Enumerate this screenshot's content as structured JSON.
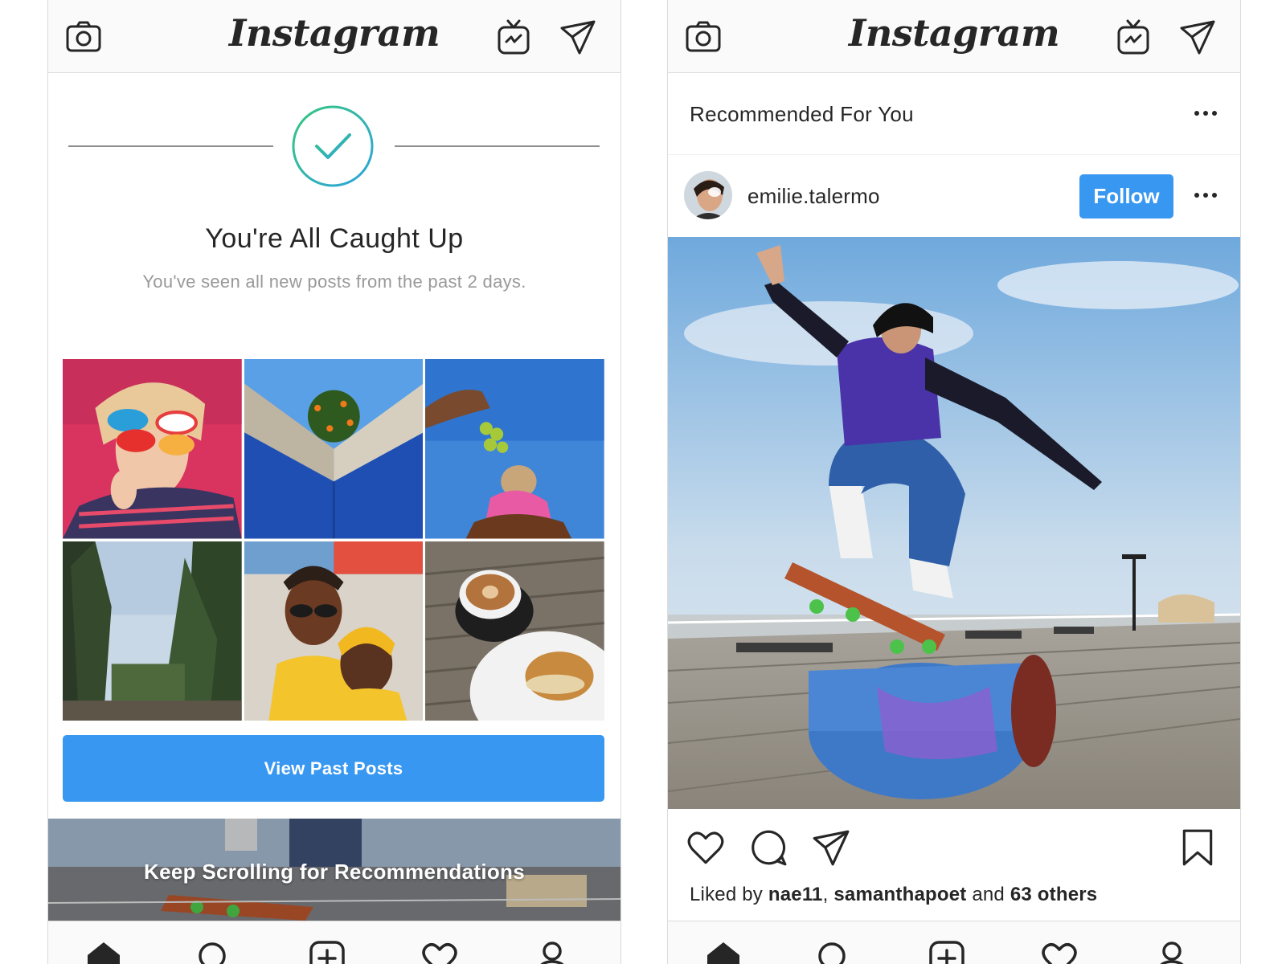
{
  "app": {
    "name": "Instagram"
  },
  "left": {
    "caught_up": {
      "title": "You're All Caught Up",
      "subtitle": "You've seen all new posts from the past 2 days."
    },
    "view_past_button": "View Past Posts",
    "recommendations_banner": "Keep Scrolling for Recommendations",
    "thumbnails": [
      "woman-with-colorful-sunglasses",
      "blue-wall-with-orange-tree",
      "dog-with-grapes",
      "forest-trees",
      "two-friends-smiling",
      "coffee-and-sandwich"
    ]
  },
  "right": {
    "section_title": "Recommended For You",
    "post": {
      "username": "emilie.talermo",
      "follow_label": "Follow",
      "image": "skateboarder-jumping-over-barrel-on-boardwalk",
      "likes": {
        "prefix": "Liked by ",
        "user1": "nae11",
        "separator": ", ",
        "user2": "samanthapoet",
        "middle": " and ",
        "others": "63 others"
      }
    }
  },
  "icons": {
    "top": [
      "camera-icon",
      "igtv-icon",
      "direct-icon"
    ],
    "bottom_nav": [
      "home-icon",
      "search-icon",
      "new-post-icon",
      "activity-icon",
      "profile-icon"
    ],
    "post_actions": [
      "like-icon",
      "comment-icon",
      "share-icon",
      "save-icon"
    ]
  },
  "colors": {
    "primary_blue": "#3897f0",
    "check_gradient_start": "#34c77c",
    "check_gradient_end": "#2fa3e0",
    "text": "#262626",
    "secondary_text": "#999999"
  }
}
